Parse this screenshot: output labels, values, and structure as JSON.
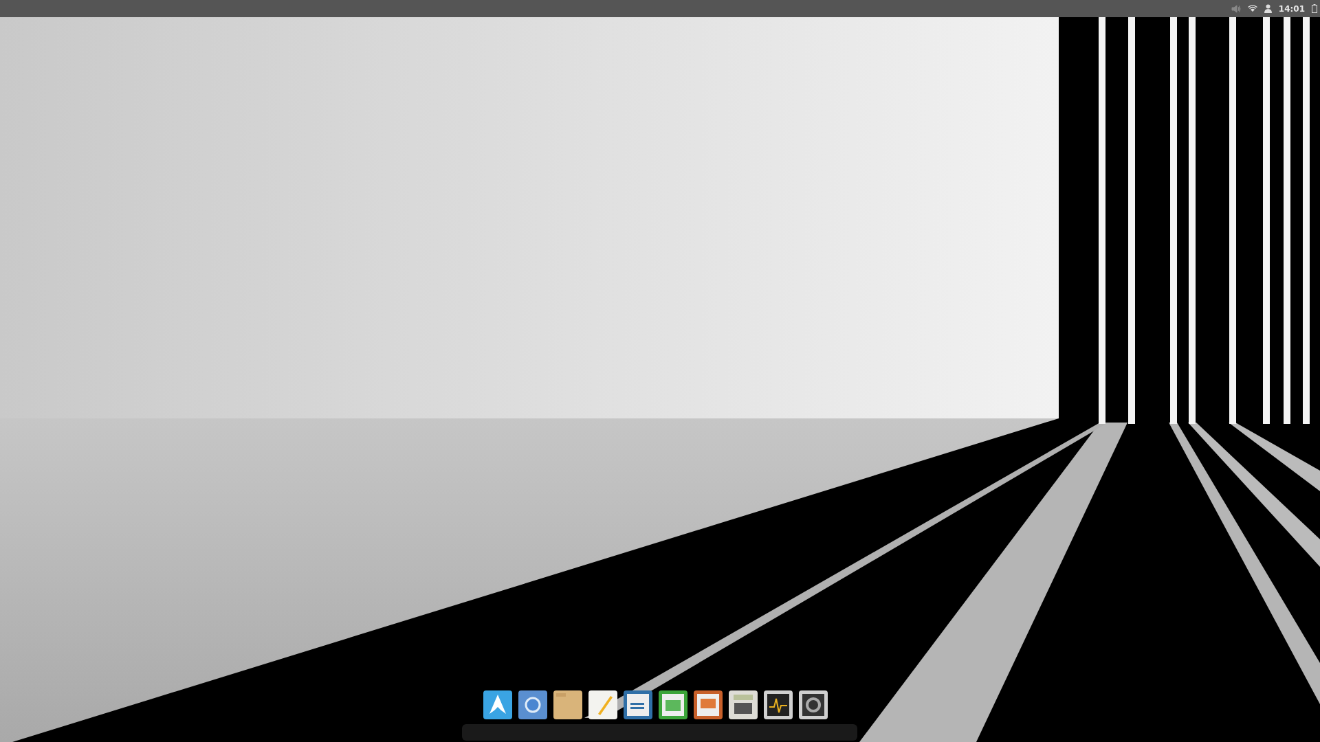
{
  "top_bar": {
    "clock": "14:01"
  }
}
